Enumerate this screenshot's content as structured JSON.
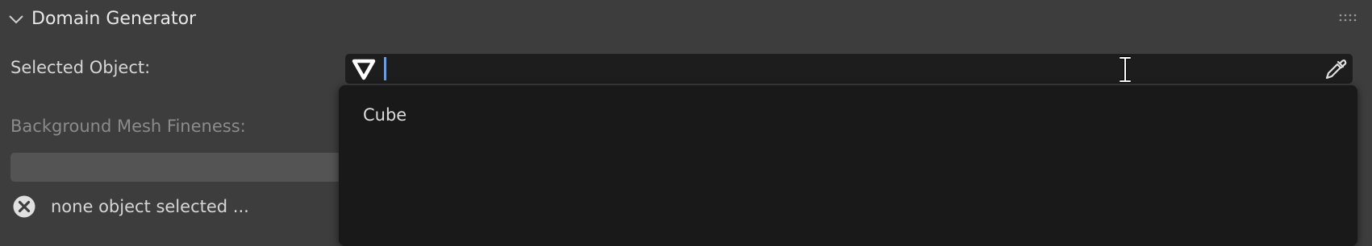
{
  "panel": {
    "title": "Domain Generator",
    "icons": {
      "collapse": "chevron-down-icon",
      "drag": "drag-handle-icon"
    }
  },
  "selected_object": {
    "label": "Selected Object:",
    "value": "",
    "icons": {
      "mesh": "mesh-data-icon",
      "pick": "eyedropper-icon"
    }
  },
  "fineness": {
    "label": "Background Mesh Fineness:"
  },
  "status": {
    "icon": "error-icon",
    "text": "none object selected ..."
  },
  "dropdown": {
    "items": [
      {
        "label": "Cube"
      }
    ]
  },
  "colors": {
    "panel_bg": "#3d3d3d",
    "field_bg": "#1d1d1d",
    "dropdown_bg": "#191919",
    "caret": "#6e9cdc",
    "disabled_text": "#8b8b8b"
  }
}
